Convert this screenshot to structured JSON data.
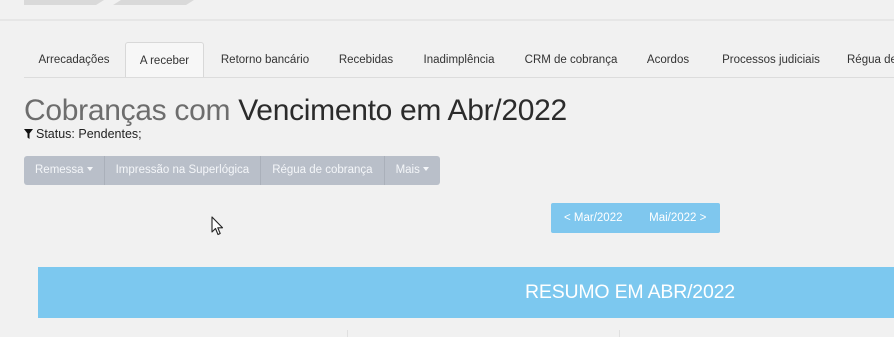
{
  "tabs": [
    {
      "label": "Arrecadações"
    },
    {
      "label": "A receber",
      "active": true
    },
    {
      "label": "Retorno bancário"
    },
    {
      "label": "Recebidas"
    },
    {
      "label": "Inadimplência"
    },
    {
      "label": "CRM de cobrança"
    },
    {
      "label": "Acordos"
    },
    {
      "label": "Processos judiciais"
    },
    {
      "label": "Régua de"
    }
  ],
  "page": {
    "title_light": "Cobranças com",
    "title_dark": "Vencimento em Abr/2022",
    "filter_text": "Status: Pendentes;"
  },
  "actions": {
    "remessa": "Remessa",
    "impressao": "Impressão na Superlógica",
    "regua": "Régua de cobrança",
    "mais": "Mais"
  },
  "month_nav": {
    "prev": "< Mar/2022",
    "next": "Mai/2022 >"
  },
  "summary": {
    "title": "RESUMO EM ABR/2022"
  },
  "icons": [
    "filter-icon",
    "mouse-cursor-icon",
    "caret-down-icon"
  ],
  "colors": {
    "banner": "#7cc8ef",
    "nav_buttons": "#7fc7ee",
    "action_buttons": "#b9bfc9",
    "background": "#f1f1f1"
  }
}
